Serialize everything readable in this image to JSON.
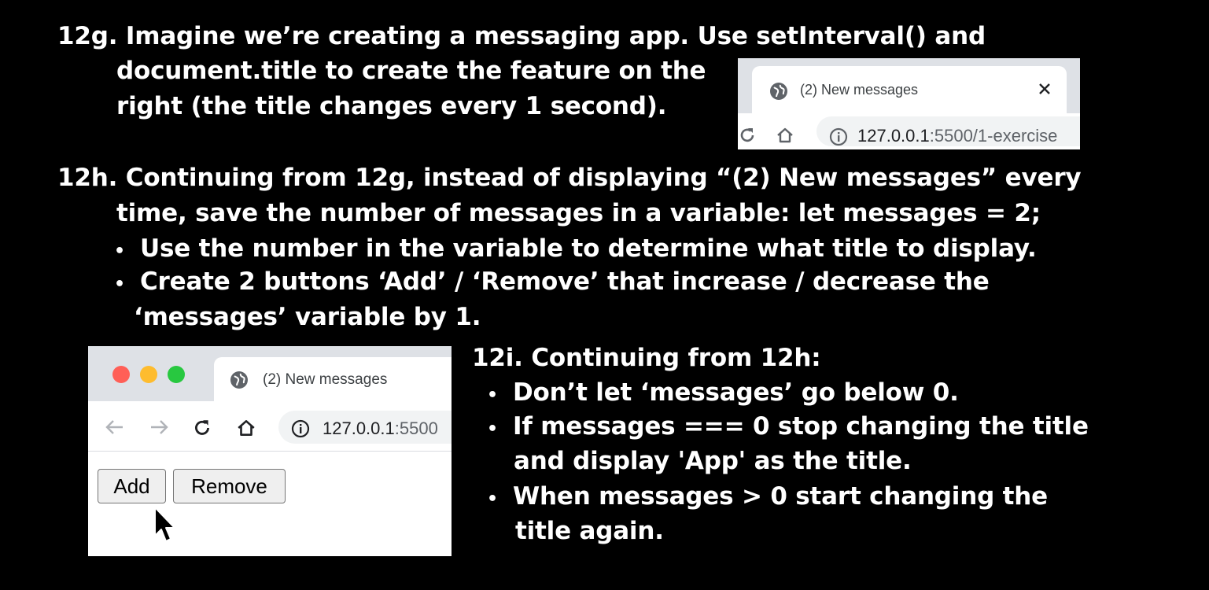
{
  "exercise_12g": {
    "line1": "12g. Imagine we’re creating a messaging app. Use setInterval() and",
    "line2": "document.title to create the feature on the",
    "line3": "right (the title changes every 1 second)."
  },
  "exercise_12h": {
    "line1": "12h. Continuing from 12g, instead of displaying “(2) New messages” every",
    "line2": "time, save the number of messages in a variable: let messages = 2;",
    "bullet1": "Use the number in the variable to determine what title to display.",
    "bullet2_line1": "Create 2 buttons ‘Add’ / ‘Remove’ that increase / decrease the",
    "bullet2_line2": "‘messages’ variable by 1."
  },
  "exercise_12i": {
    "heading": "12i. Continuing from 12h:",
    "bullet1": "Don’t let ‘messages’ go below 0.",
    "bullet2_line1": "If messages === 0 stop changing the title",
    "bullet2_line2": "and display 'App' as the title.",
    "bullet3_line1": "When messages > 0 start changing the",
    "bullet3_line2": "title again."
  },
  "bullet_char": "•",
  "screenshot_tab": {
    "tab_title": "(2) New messages",
    "url_host": "127.0.0.1",
    "url_path": ":5500/1-exercise"
  },
  "screenshot_app": {
    "tab_title": "(2) New messages",
    "url_host": "127.0.0.1",
    "url_path": ":5500",
    "add_label": "Add",
    "remove_label": "Remove"
  },
  "colors": {
    "background": "#000000",
    "text": "#ffffff",
    "tabbar": "#dee1e6",
    "traffic_red": "#ff5f57",
    "traffic_yellow": "#febc2e",
    "traffic_green": "#28c840"
  },
  "icons": [
    "globe-icon",
    "close-icon",
    "reload-icon",
    "home-icon",
    "info-icon",
    "back-arrow-icon",
    "forward-arrow-icon",
    "mouse-cursor-icon"
  ]
}
